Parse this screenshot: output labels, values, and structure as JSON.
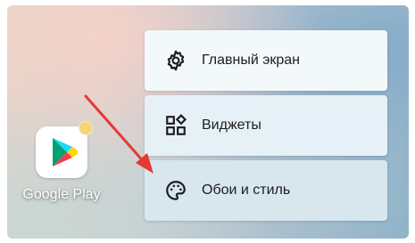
{
  "app": {
    "name": "Google Play",
    "icon": "google-play-icon"
  },
  "menu": {
    "items": [
      {
        "label": "Главный экран",
        "icon": "gear-icon",
        "bg": "#f3f8fb"
      },
      {
        "label": "Виджеты",
        "icon": "widgets-icon",
        "bg": "#e6f1f7"
      },
      {
        "label": "Обои и стиль",
        "icon": "palette-icon",
        "bg": "#d8e6ee"
      }
    ]
  },
  "colors": {
    "arrow": "#e53935",
    "icon": "#1d1d1d"
  }
}
